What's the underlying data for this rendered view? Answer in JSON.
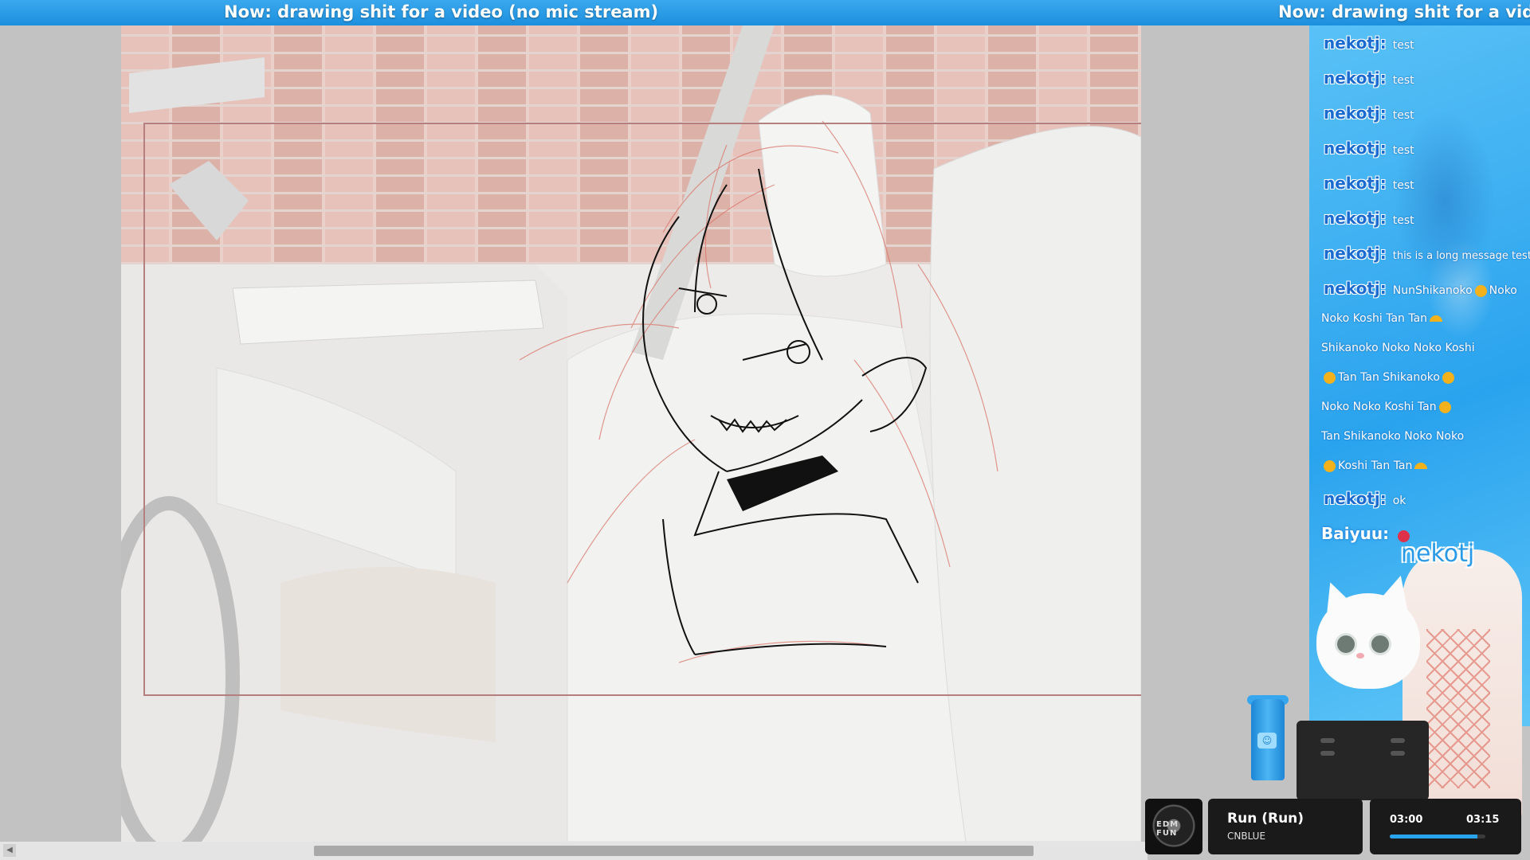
{
  "ticker": {
    "text": "Now: drawing shit for a video (no mic stream)",
    "text_repeat": "Now: drawing shit for a video (n"
  },
  "chat": {
    "messages": [
      {
        "user": "nekotj:",
        "text": "test"
      },
      {
        "user": "nekotj:",
        "text": "test"
      },
      {
        "user": "nekotj:",
        "text": "test"
      },
      {
        "user": "nekotj:",
        "text": "test"
      },
      {
        "user": "nekotj:",
        "text": "test"
      },
      {
        "user": "nekotj:",
        "text": "test"
      },
      {
        "user": "nekotj:",
        "text": "this is a long message test"
      },
      {
        "user": "nekotj:",
        "text": "NunShikanoko"
      },
      {
        "user": "nekotj:",
        "text": "ok"
      },
      {
        "user": "Baiyuu:",
        "text": ""
      }
    ],
    "emote_lines": [
      "Noko",
      "Noko Koshi Tan Tan",
      "Shikanoko Noko Noko Koshi",
      "Tan Tan Shikanoko",
      "Noko Noko Koshi Tan",
      "Tan Shikanoko Noko Noko",
      "Koshi Tan Tan"
    ]
  },
  "overlay": {
    "brand": "nekotj",
    "bottle_icon": "cat-logo-icon"
  },
  "player": {
    "disc_label": "EDM FUN",
    "song_title": "Run (Run)",
    "artist": "CNBLUE",
    "time_current": "03:00",
    "time_total": "03:15",
    "progress": 0.92
  },
  "colors": {
    "accent": "#2aa3ee",
    "sketch_red": "#d9776a",
    "frame": "#b57f7f"
  }
}
